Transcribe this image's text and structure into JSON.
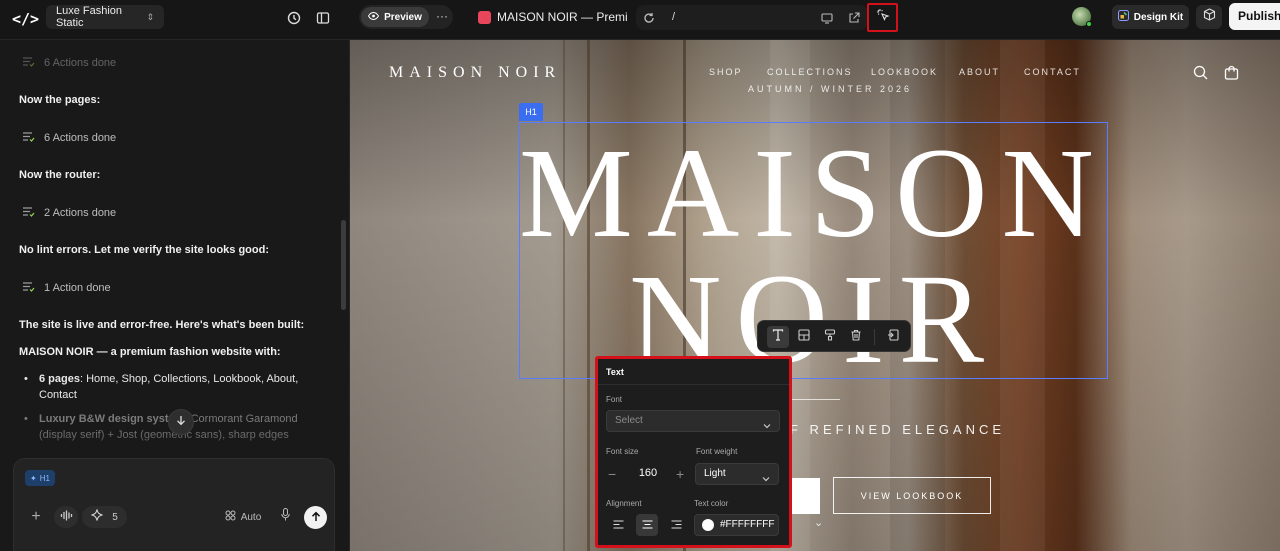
{
  "topbar": {
    "project_name": "Luxe Fashion Static",
    "preview_label": "Preview",
    "more_label": "···",
    "page_title": "MAISON NOIR — Premi...",
    "url": "/",
    "design_kit_label": "Design Kit",
    "publish_label": "Publish"
  },
  "chat": {
    "items": [
      {
        "type": "action",
        "label": "6 Actions done"
      },
      {
        "type": "message",
        "text": "Now the pages:"
      },
      {
        "type": "action",
        "label": "6 Actions done"
      },
      {
        "type": "message",
        "text": "Now the router:"
      },
      {
        "type": "action",
        "label": "2 Actions done"
      },
      {
        "type": "message",
        "text": "No lint errors. Let me verify the site looks good:"
      },
      {
        "type": "action",
        "label": "1 Action done"
      }
    ],
    "summary_intro": "The site is live and error-free. Here's what's been built:",
    "summary_title": "MAISON NOIR — a premium fashion website with:",
    "bullets": [
      {
        "bold": "6 pages",
        "text": ": Home, Shop, Collections, Lookbook, About, Contact"
      },
      {
        "bold": "Luxury B&W design system",
        "text": ": Cormorant Garamond (display serif) + Jost (geometric sans), sharp edges"
      }
    ],
    "composer": {
      "chip_label": "H1",
      "credits_count": "5",
      "auto_label": "Auto"
    }
  },
  "site": {
    "brand": "MAISON NOIR",
    "nav": [
      "SHOP",
      "COLLECTIONS",
      "LOOKBOOK",
      "ABOUT",
      "CONTACT"
    ],
    "season": "AUTUMN / WINTER 2026",
    "headline_line1": "MAISON",
    "headline_line2": "NOIR",
    "tagline": "F REFINED ELEGANCE",
    "secondary_cta": "VIEW LOOKBOOK"
  },
  "selection": {
    "tag": "H1"
  },
  "text_panel": {
    "title": "Text",
    "font_label": "Font",
    "font_placeholder": "Select",
    "font_size_label": "Font size",
    "font_size_value": "160",
    "font_weight_label": "Font weight",
    "font_weight_value": "Light",
    "alignment_label": "Alignment",
    "alignment_selected": "center",
    "text_color_label": "Text color",
    "text_color_value": "#FFFFFFFF"
  },
  "colors": {
    "accent_blue": "#3a6df0",
    "highlight_red": "#d4101a",
    "publish_bg": "#f4f4f4"
  }
}
